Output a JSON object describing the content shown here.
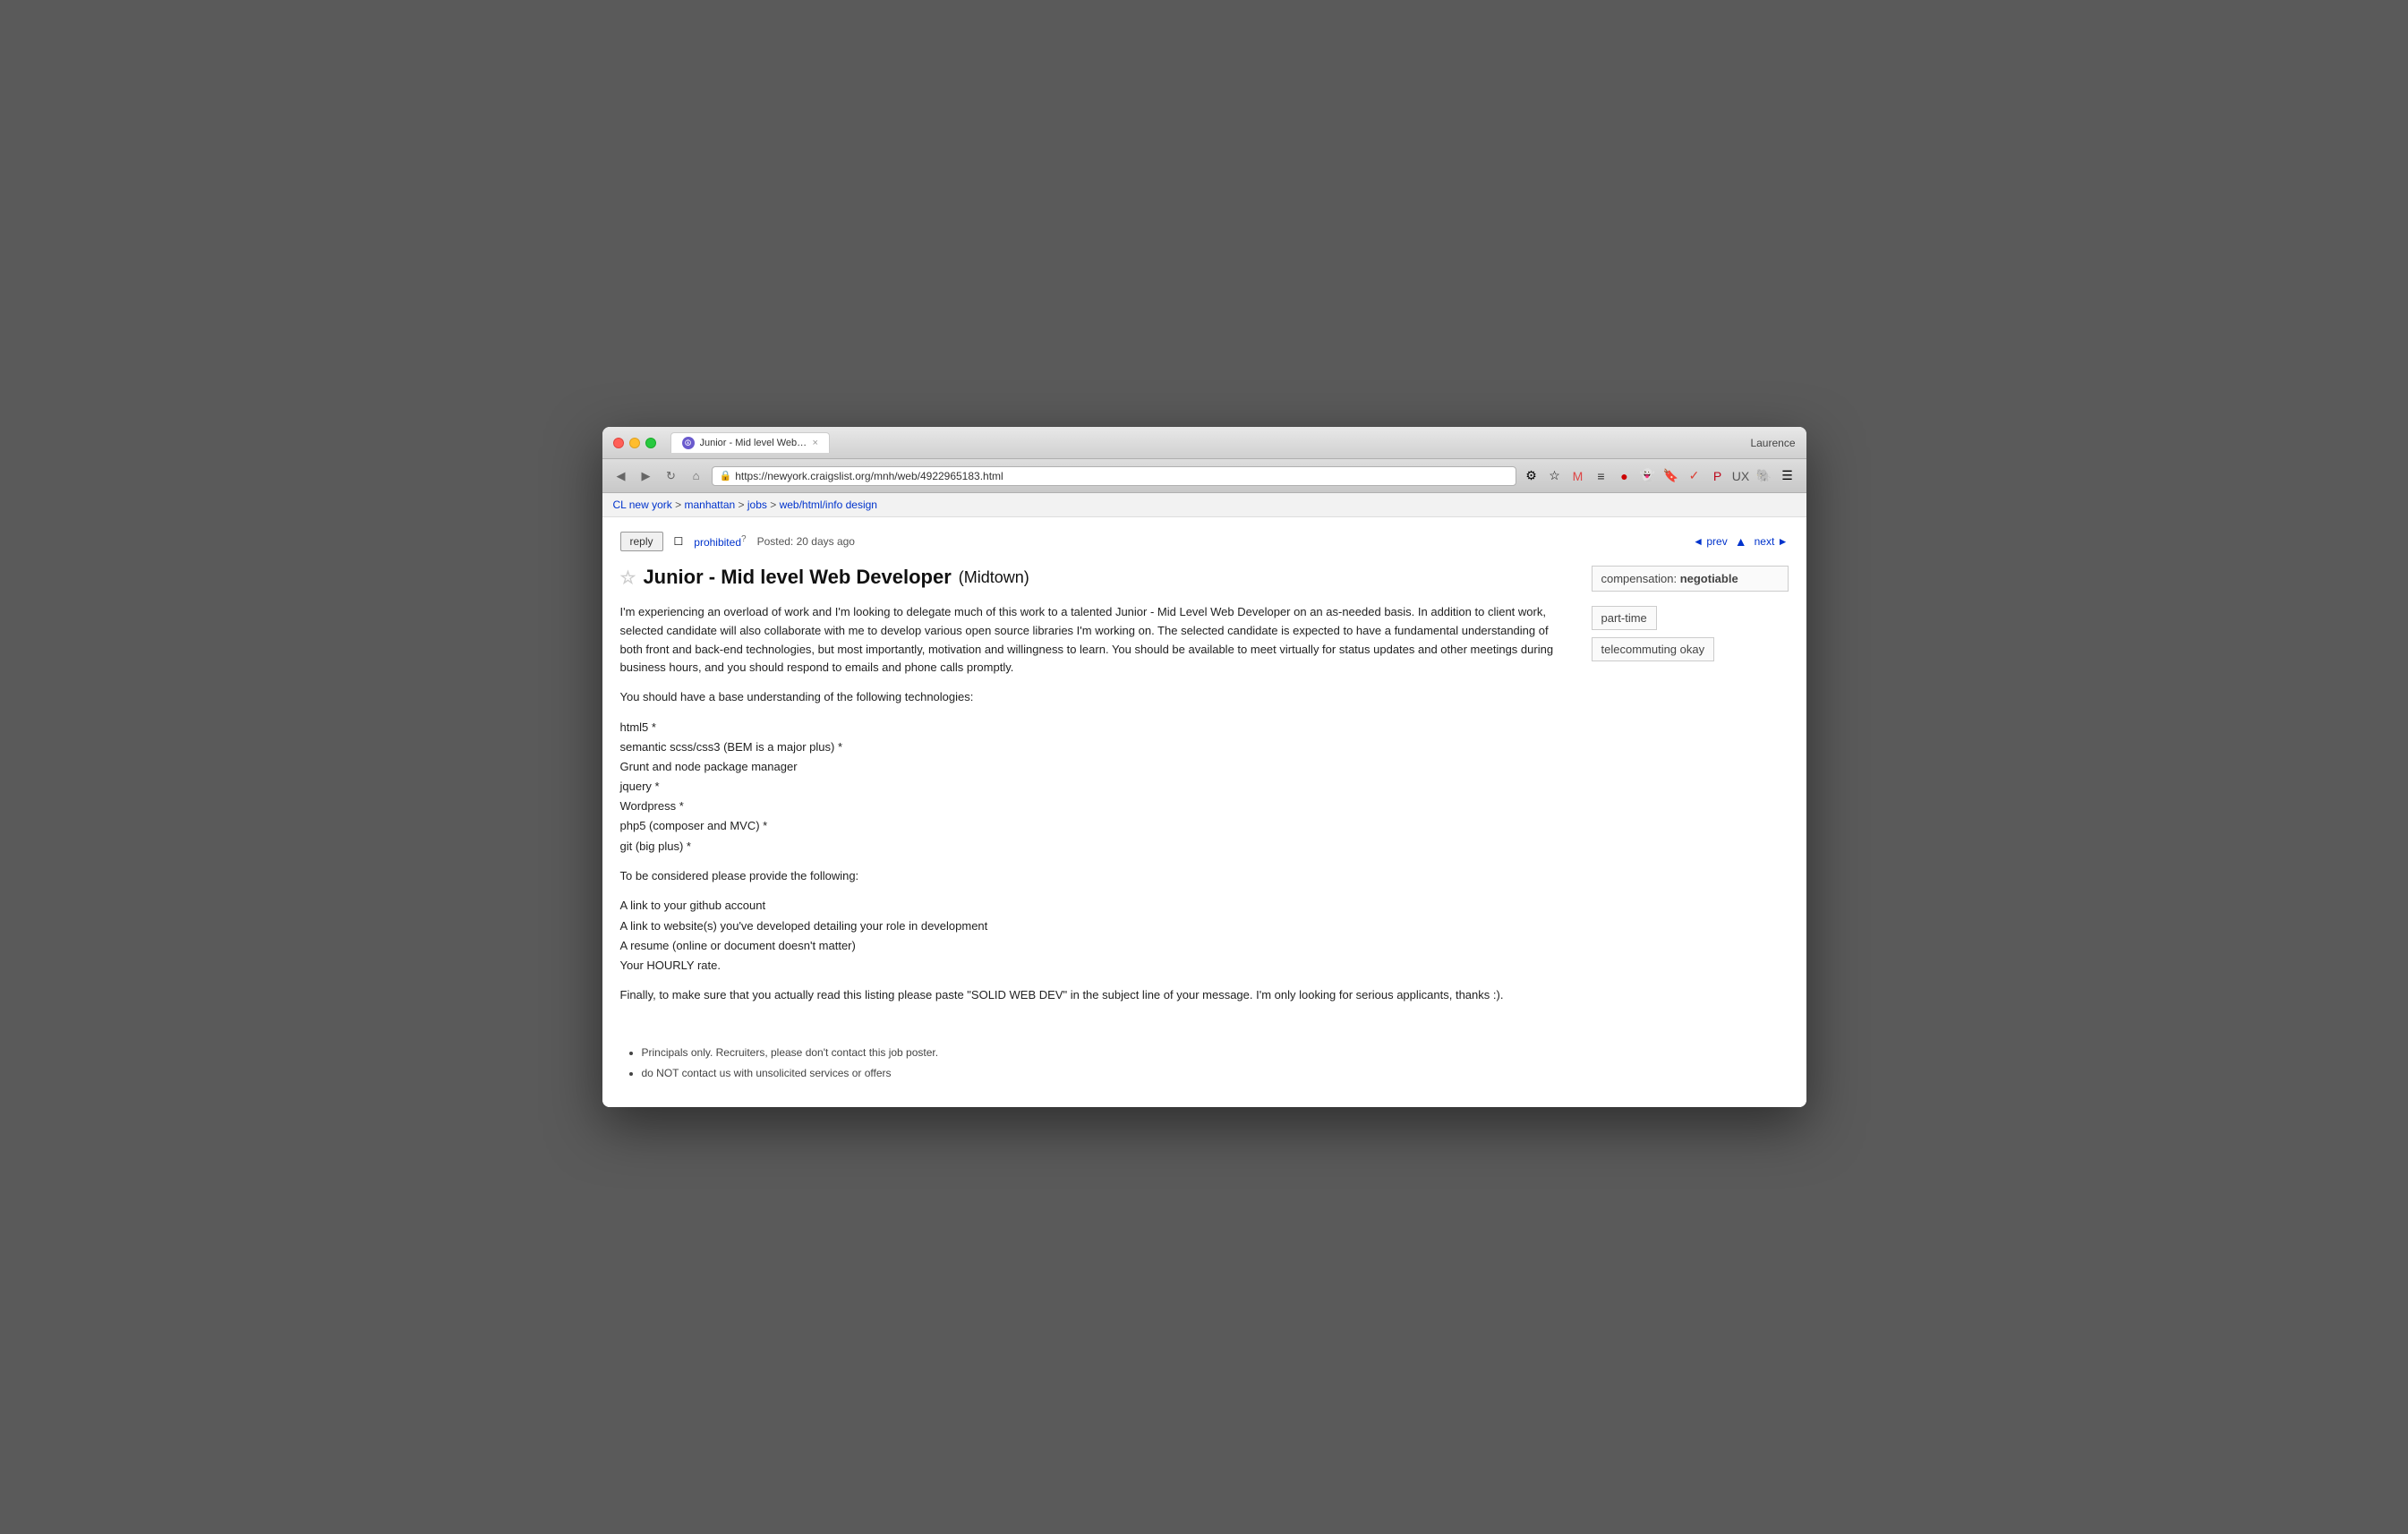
{
  "browser": {
    "user": "Laurence",
    "tab_favicon": "☮",
    "tab_title": "Junior - Mid level Web Dev",
    "tab_close": "×",
    "url": "https://newyork.craigslist.org/mnh/web/4922965183.html",
    "url_https": "https://",
    "url_domain": "newyork.craigslist.org",
    "url_path": "/mnh/web/4922965183.html"
  },
  "breadcrumb": {
    "cl": "CL",
    "new_york": "new york",
    "manhattan": "manhattan",
    "jobs": "jobs",
    "category": "web/html/info design"
  },
  "controls": {
    "reply_label": "reply",
    "prohibited_label": "prohibited",
    "flag_num": "?",
    "posted": "Posted: 20 days ago",
    "prev": "◄ prev",
    "next": "next ►"
  },
  "post": {
    "title": "Junior - Mid level Web Developer",
    "location": "(Midtown)",
    "body_p1": "I'm experiencing an overload of work and I'm looking to delegate much of this work to a talented Junior - Mid Level Web Developer on an as-needed basis. In addition to client work, selected candidate will also collaborate with me to develop various open source libraries I'm working on. The selected candidate is expected to have a fundamental understanding of both front and back-end technologies, but most importantly, motivation and willingness to learn. You should be available to meet virtually for status updates and other meetings during business hours, and you should respond to emails and phone calls promptly.",
    "body_p2": "You should have a base understanding of the following technologies:",
    "technologies": [
      "html5 *",
      "semantic scss/css3 (BEM is a major plus) *",
      "Grunt and node package manager",
      "jquery *",
      "Wordpress *",
      "php5 (composer and MVC) *",
      "git (big plus) *"
    ],
    "body_p3": "To be considered please provide the following:",
    "requirements": [
      "A link to your github account",
      "A link to website(s) you've developed detailing your role in development",
      "A resume (online or document doesn't matter)",
      "Your HOURLY rate."
    ],
    "body_p4": "Finally, to make sure that you actually read this listing please paste \"SOLID WEB DEV\" in the subject line of your message. I'm only looking for serious applicants, thanks :).",
    "footer_items": [
      "Principals only. Recruiters, please don't contact this job poster.",
      "do NOT contact us with unsolicited services or offers"
    ]
  },
  "sidebar": {
    "compensation_label": "compensation:",
    "compensation_value": "negotiable",
    "tag1": "part-time",
    "tag2": "telecommuting okay"
  }
}
